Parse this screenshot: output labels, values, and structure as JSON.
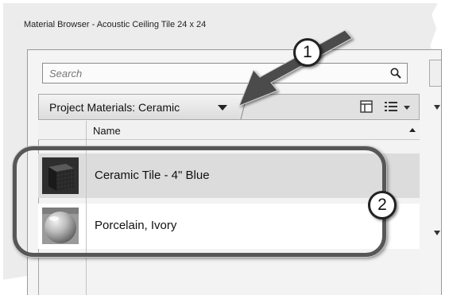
{
  "window": {
    "title": "Material Browser - Acoustic Ceiling Tile 24 x 24"
  },
  "search": {
    "placeholder": "Search",
    "icon": "search-icon"
  },
  "toolbar": {
    "library_dropdown_label": "Project Materials: Ceramic",
    "icons": [
      "layout-icon",
      "list-view-icon"
    ]
  },
  "table": {
    "columns": [
      "Name"
    ],
    "rows": [
      {
        "name": "Ceramic Tile - 4\" Blue",
        "thumbnail": "dark-blue-tile-cube",
        "selected": true
      },
      {
        "name": "Porcelain, Ivory",
        "thumbnail": "ivory-sphere",
        "selected": false
      }
    ]
  },
  "callouts": {
    "one": "1",
    "two": "2"
  },
  "colors": {
    "callout_stroke": "#575757",
    "selected_row": "#dcdcdc",
    "panel_background": "#ececec"
  }
}
